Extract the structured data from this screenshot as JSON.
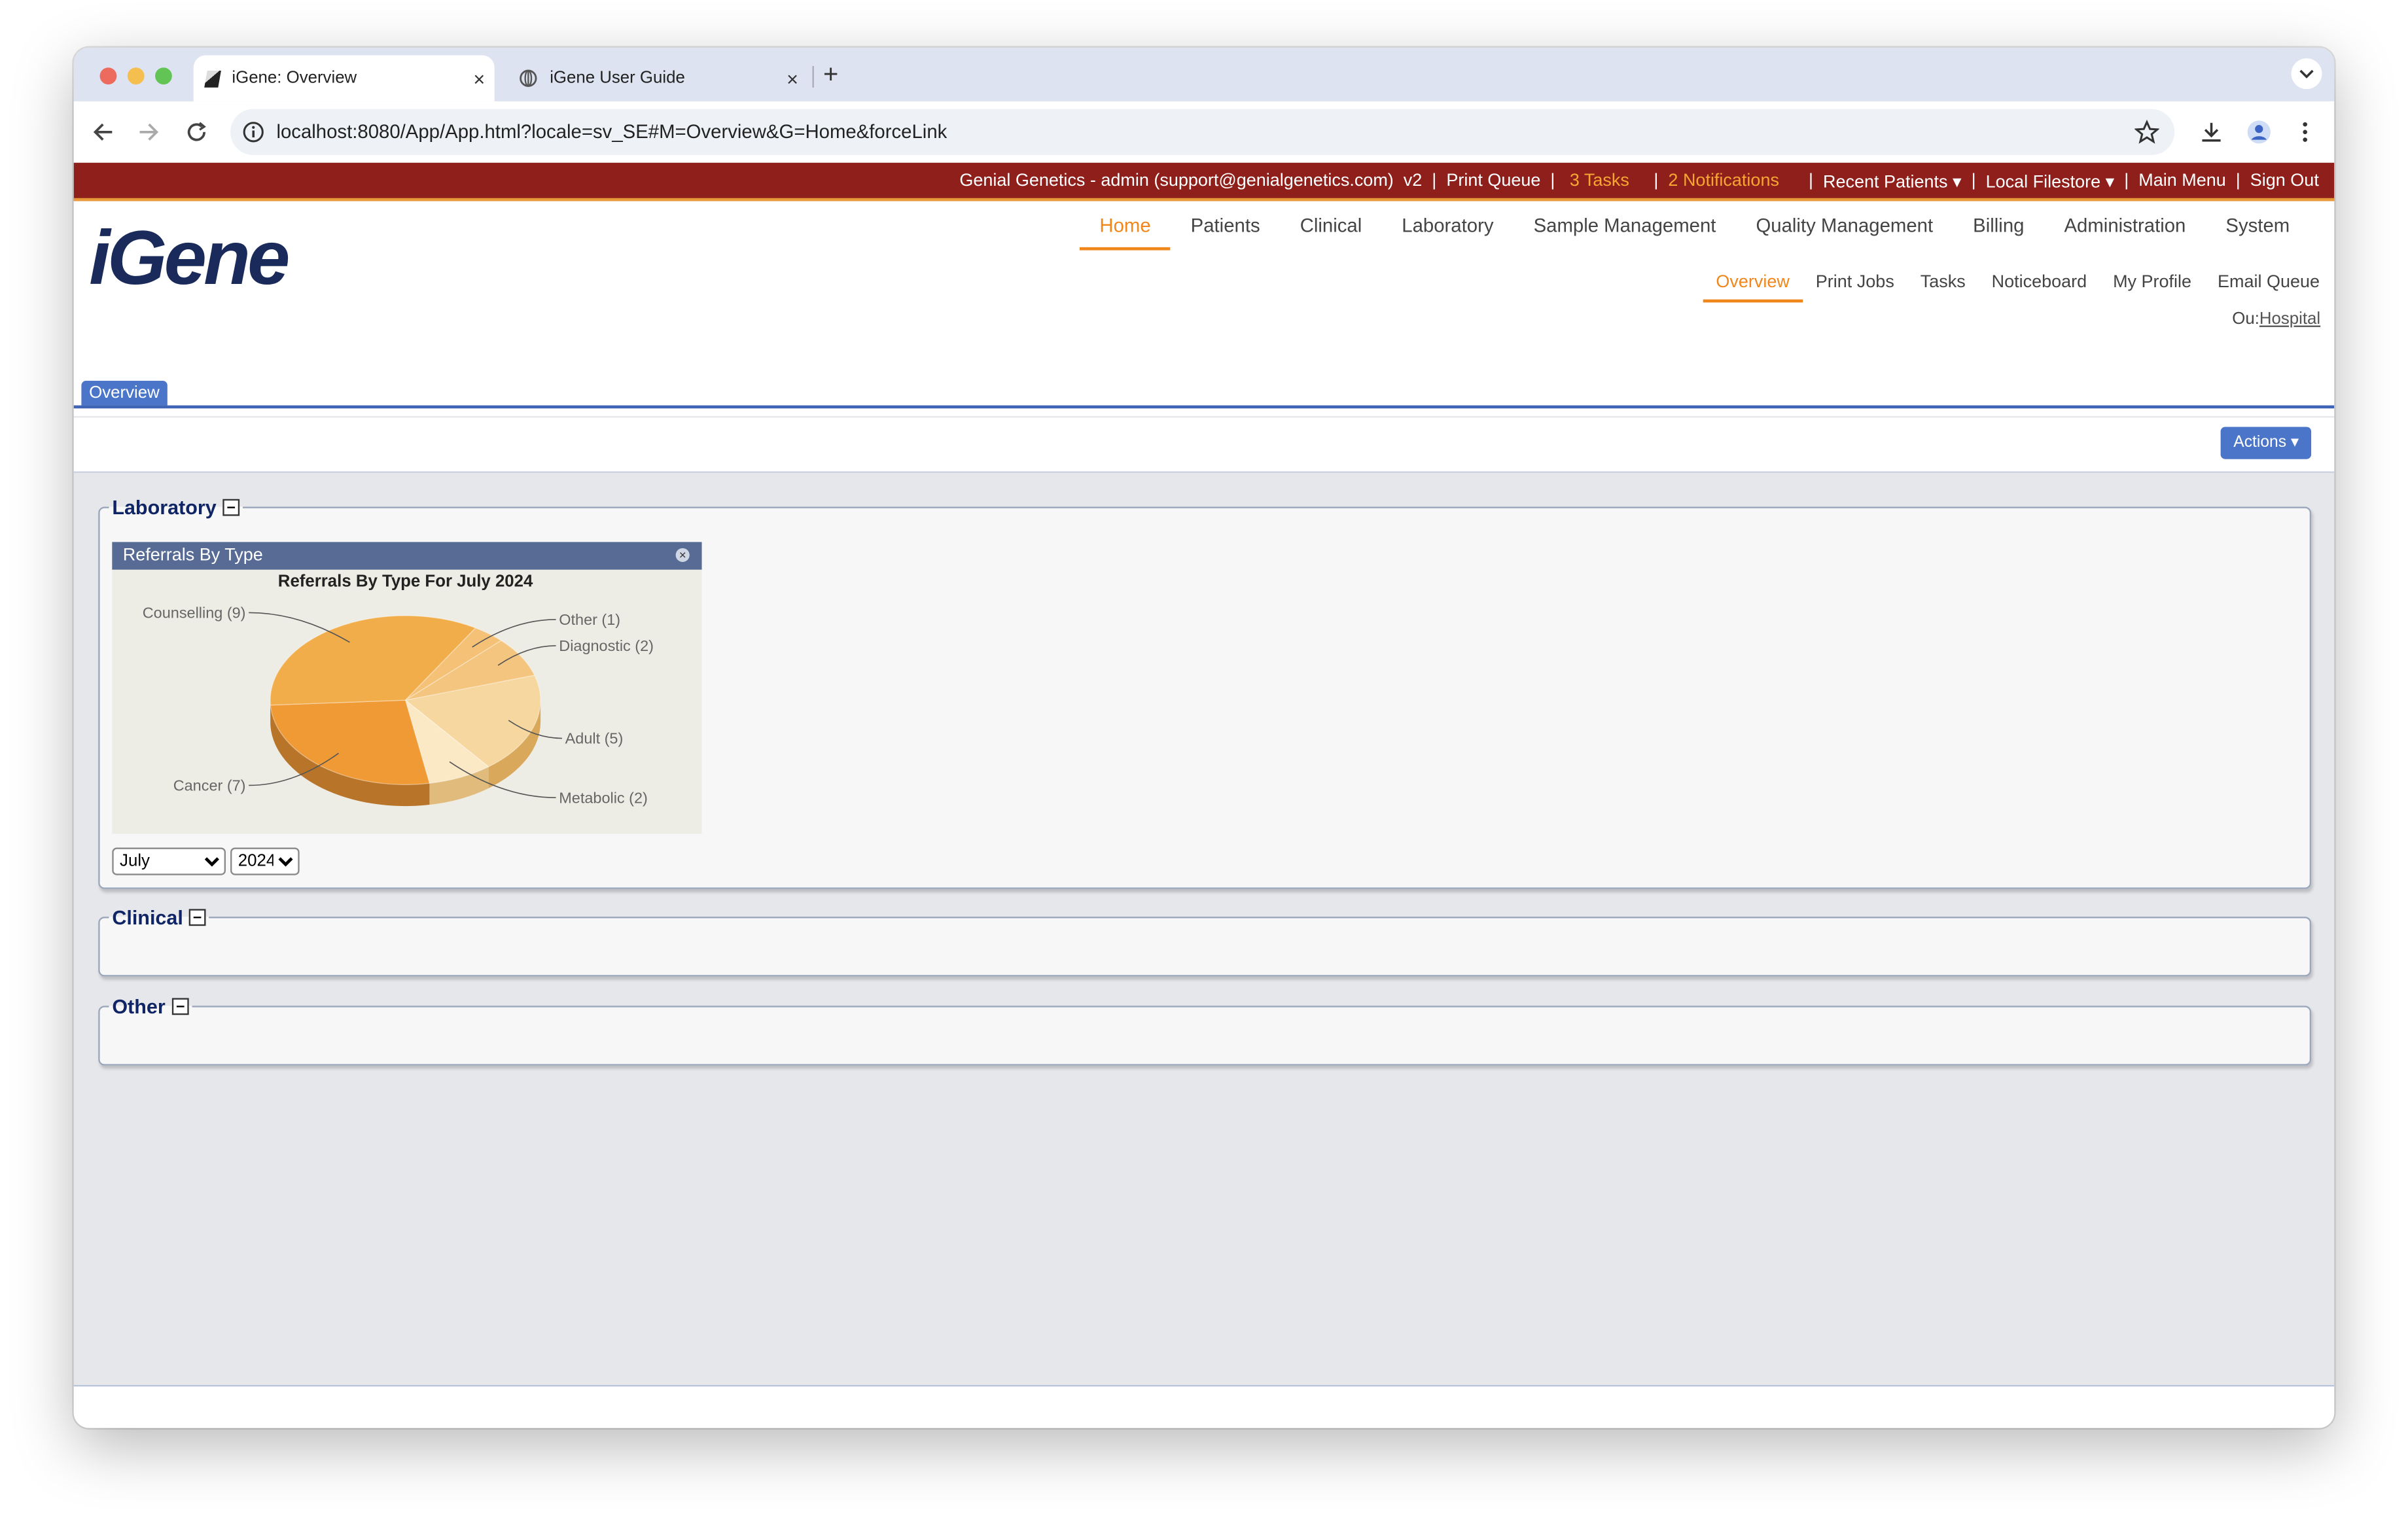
{
  "browser": {
    "tabs": [
      {
        "title": "iGene: Overview",
        "close": "×"
      },
      {
        "title": "iGene User Guide",
        "close": "×"
      }
    ],
    "new_tab": "+",
    "url": "localhost:8080/App/App.html?locale=sv_SE#M=Overview&G=Home&forceLink"
  },
  "topbar": {
    "user": "Genial Genetics - admin (support@genialgenetics.com)  v2",
    "print_queue": "Print Queue",
    "tasks": "3 Tasks",
    "notifications": "2 Notifications",
    "recent_patients": "Recent Patients ▾",
    "local_filestore": "Local Filestore ▾",
    "main_menu": "Main Menu",
    "sign_out": "Sign Out",
    "sep": "|"
  },
  "app": {
    "logo": "iGene",
    "main_nav": [
      "Home",
      "Patients",
      "Clinical",
      "Laboratory",
      "Sample Management",
      "Quality Management",
      "Billing",
      "Administration",
      "System"
    ],
    "sub_nav": [
      "Overview",
      "Print Jobs",
      "Tasks",
      "Noticeboard",
      "My Profile",
      "Email Queue"
    ],
    "ou_label": "Ou:",
    "ou_value": "Hospital",
    "page_tab": "Overview",
    "actions_button": "Actions ▾"
  },
  "sections": {
    "laboratory": "Laboratory",
    "clinical": "Clinical",
    "other": "Other"
  },
  "portlet": {
    "title": "Referrals By Type",
    "month": "July",
    "year": "2024",
    "months": [
      "July"
    ],
    "years": [
      "2024"
    ]
  },
  "chart_data": {
    "type": "pie",
    "title": "Referrals By Type For July 2024",
    "categories": [
      "Adult",
      "Metabolic",
      "Cancer",
      "Counselling",
      "Other",
      "Diagnostic"
    ],
    "values": [
      5,
      2,
      7,
      9,
      1,
      2
    ],
    "labels": [
      "Adult (5)",
      "Metabolic (2)",
      "Cancer (7)",
      "Counselling (9)",
      "Other (1)",
      "Diagnostic (2)"
    ],
    "colors": [
      "#f7d7a0",
      "#fbe8c5",
      "#f09a35",
      "#f2ad4b",
      "#f5c176",
      "#f4c57e"
    ],
    "side_colors": [
      "#d9a85a",
      "#e0bb7c",
      "#b8752a",
      "#c68a3a",
      "#cc9a55",
      "#cc9a55"
    ]
  }
}
